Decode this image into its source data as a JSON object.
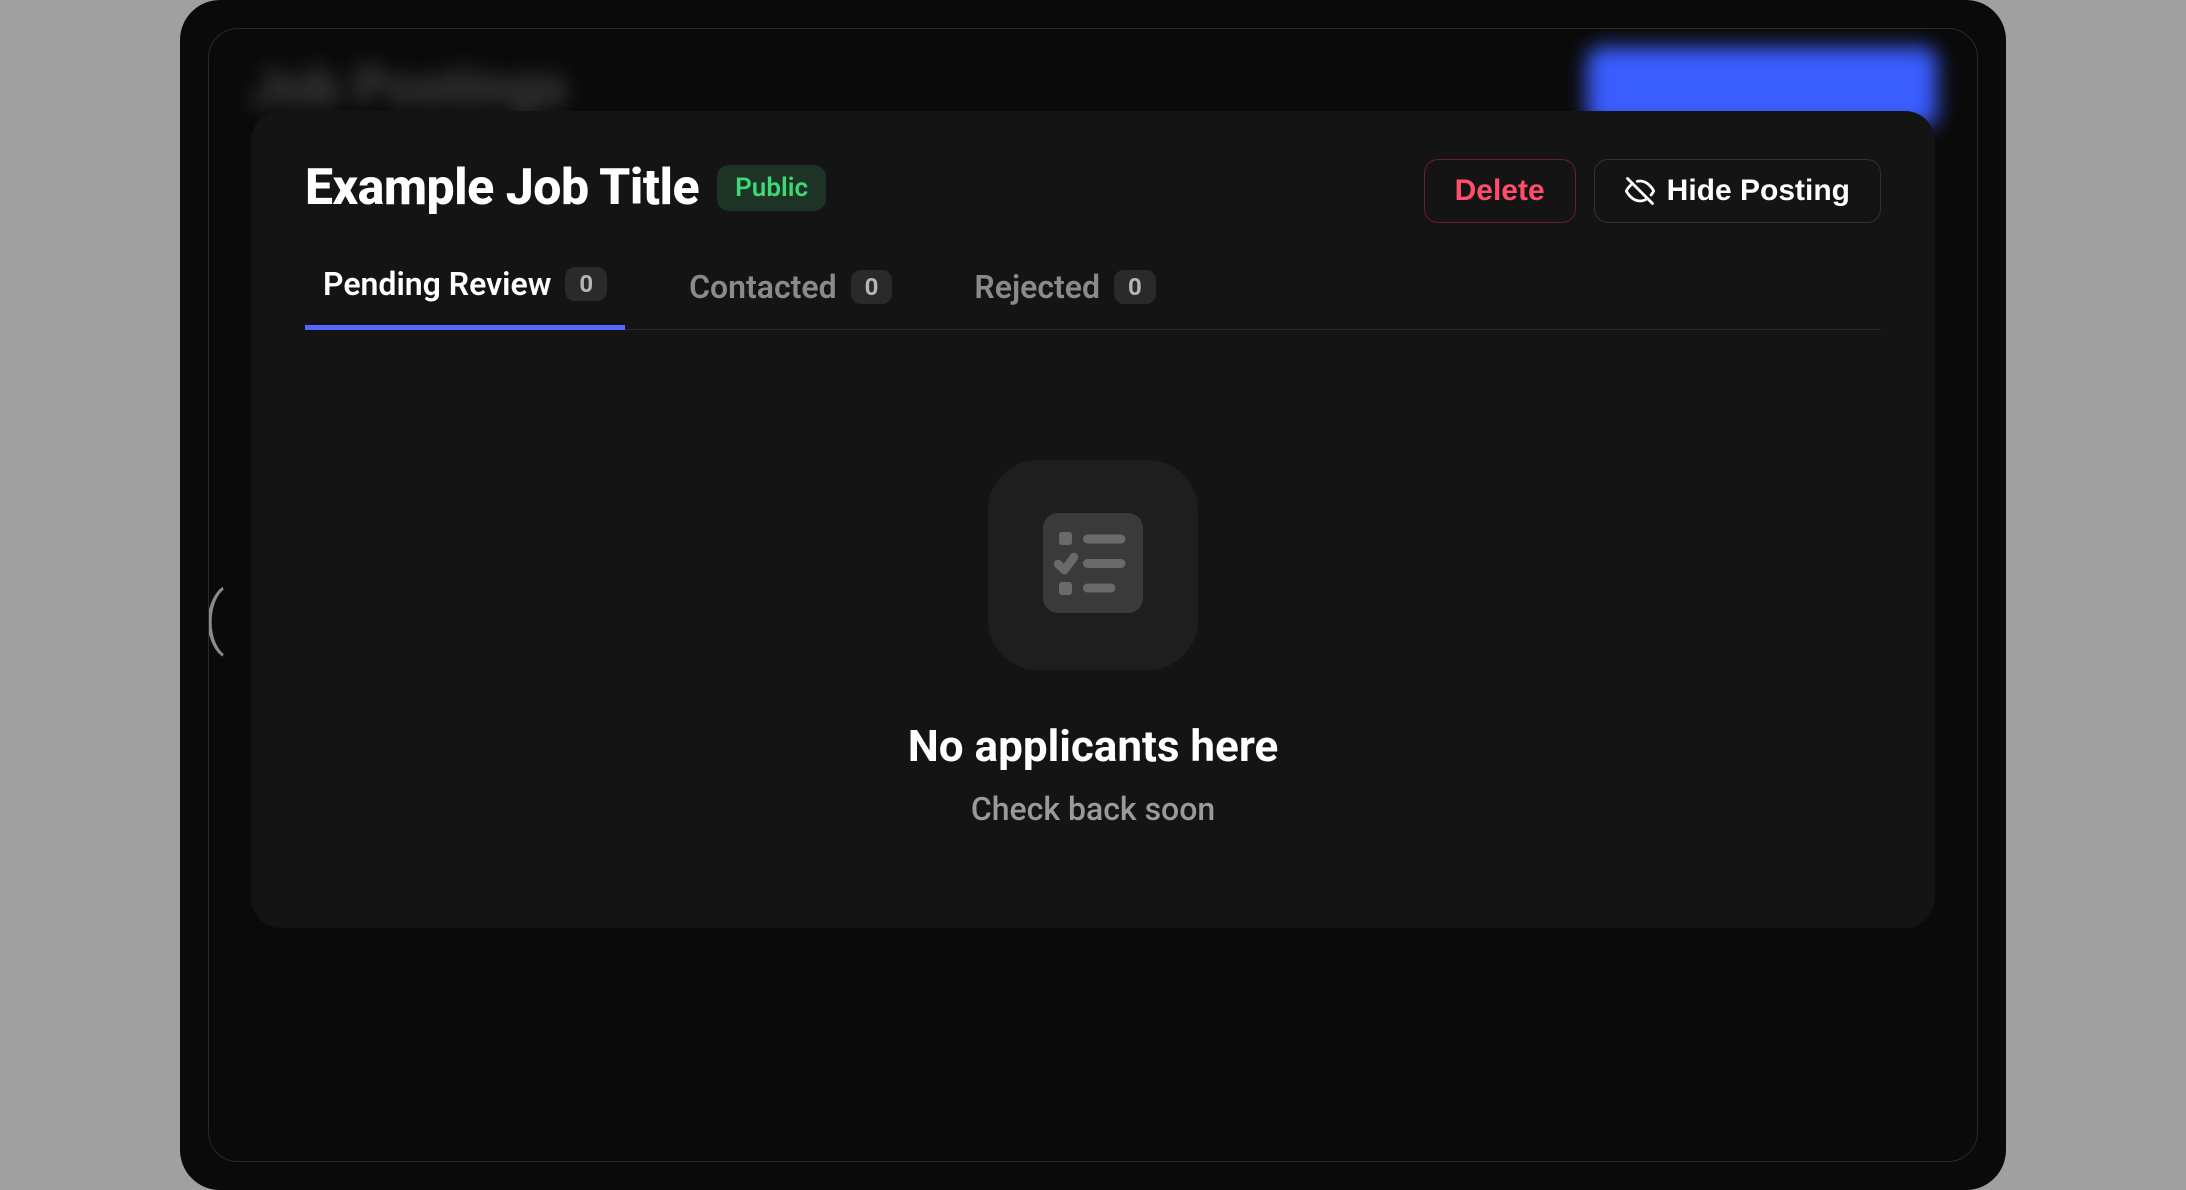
{
  "background": {
    "title_blur": "Job Postings"
  },
  "modal": {
    "title": "Example Job Title",
    "status_label": "Public",
    "actions": {
      "delete_label": "Delete",
      "hide_label": "Hide Posting"
    },
    "tabs": [
      {
        "label": "Pending Review",
        "count": "0",
        "active": true
      },
      {
        "label": "Contacted",
        "count": "0",
        "active": false
      },
      {
        "label": "Rejected",
        "count": "0",
        "active": false
      }
    ],
    "empty_state": {
      "title": "No applicants here",
      "subtitle": "Check back soon"
    }
  }
}
